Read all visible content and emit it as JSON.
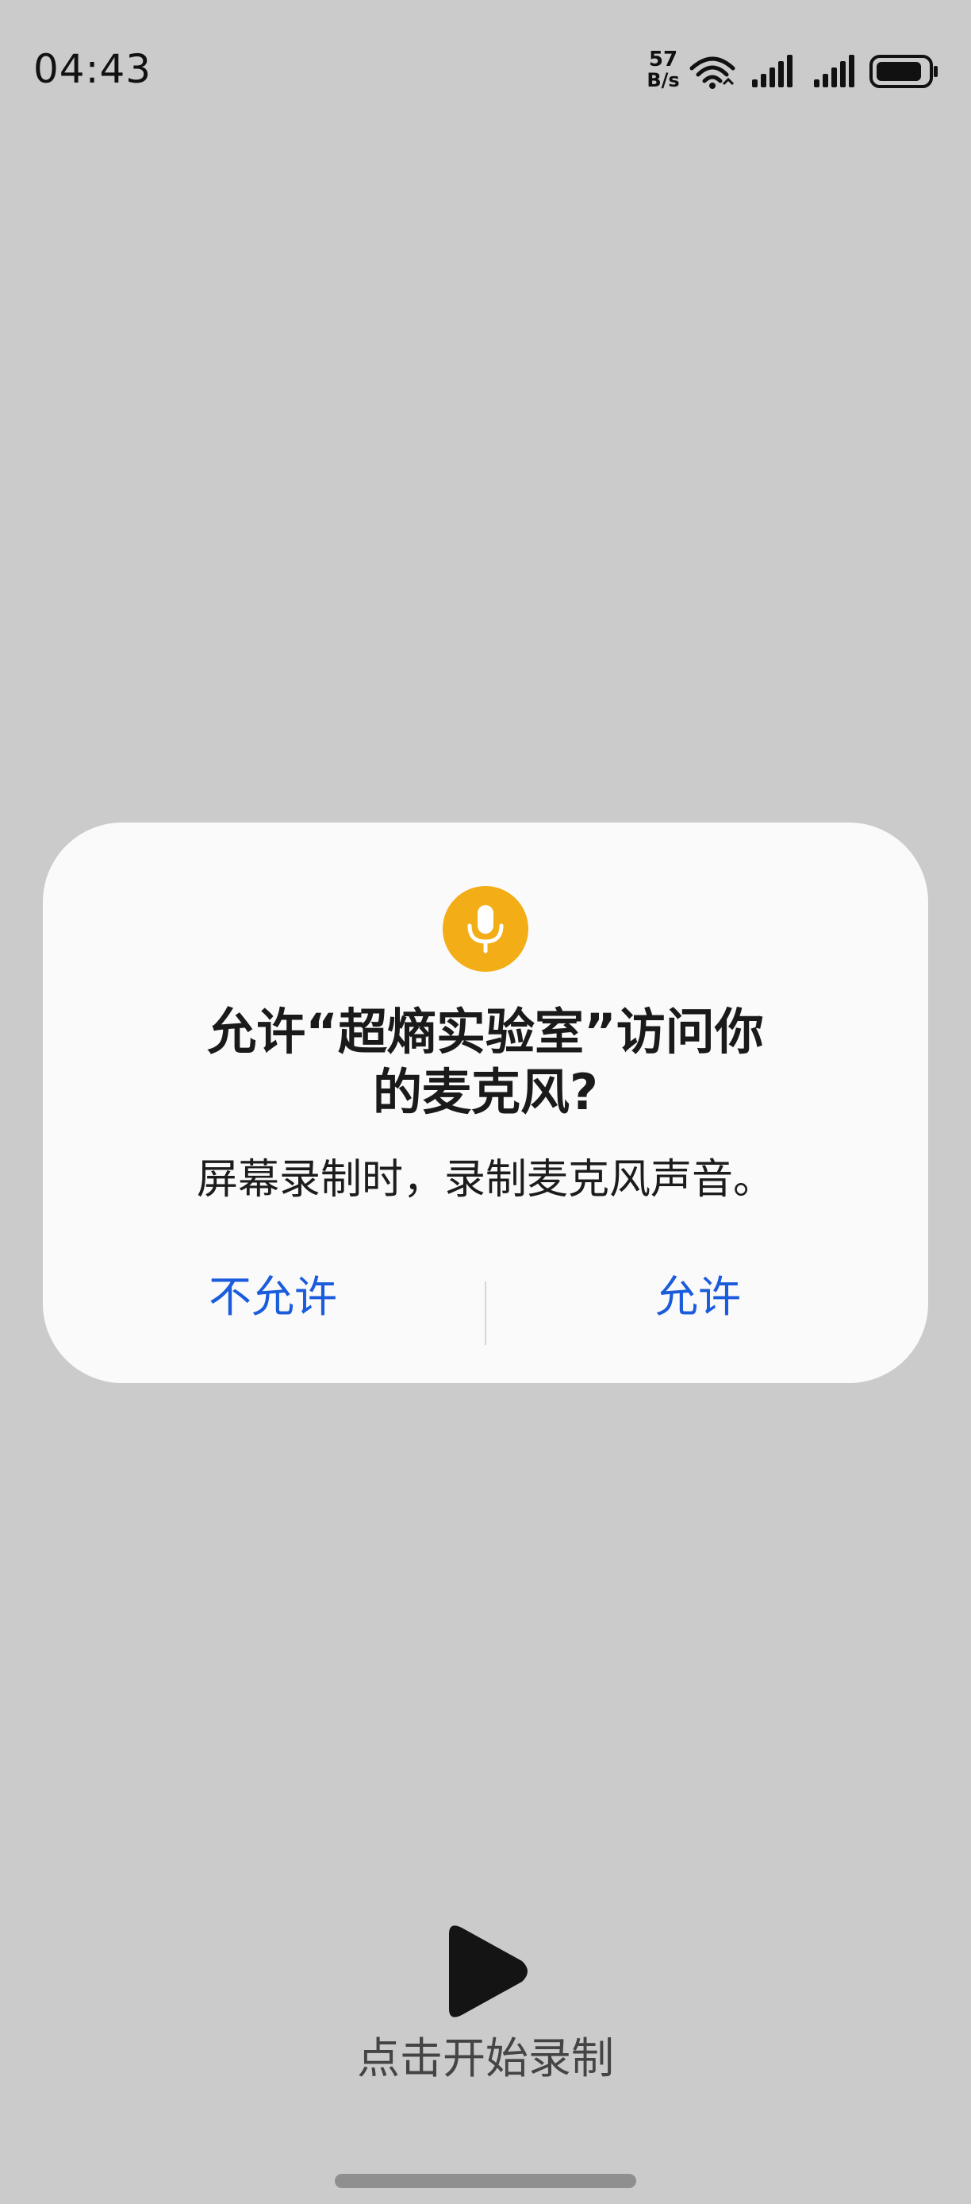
{
  "status_bar": {
    "time": "04:43",
    "net_speed_value": "57",
    "net_speed_unit": "B/s",
    "icons": [
      "wifi-icon",
      "signal-icon",
      "signal-icon",
      "battery-icon"
    ]
  },
  "dialog": {
    "icon": "microphone-icon",
    "icon_color": "#f3ad16",
    "title_line1": "允许“超熵实验室”访问你",
    "title_line2": "的麦克风?",
    "message": "屏幕录制时，录制麦克风声音。",
    "deny_label": "不允许",
    "allow_label": "允许",
    "button_color": "#1a5cdc"
  },
  "bottom": {
    "play_icon": "play-icon",
    "record_label": "点击开始录制"
  },
  "colors": {
    "background": "#cbcbcb",
    "dialog_background": "#fafafa"
  }
}
